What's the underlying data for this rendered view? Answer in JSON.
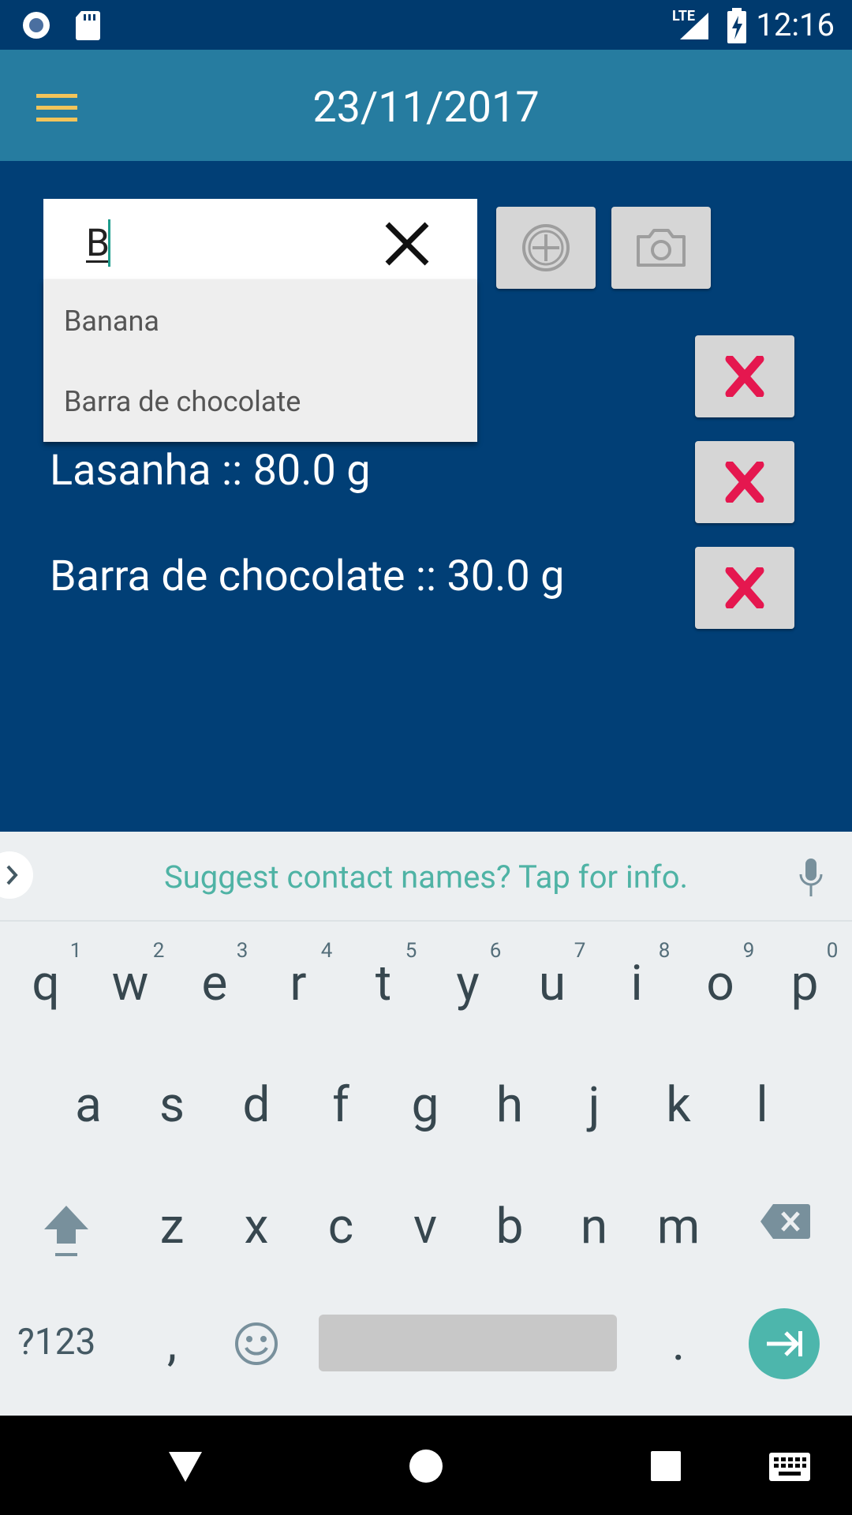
{
  "status_bar": {
    "time": "12:16",
    "network": "LTE",
    "icons": [
      "record-icon",
      "sd-card-icon",
      "signal-icon",
      "battery-charging-icon"
    ]
  },
  "toolbar": {
    "title": "23/11/2017",
    "menu_icon": "hamburger-menu-icon",
    "menu_color": "#F2C45A"
  },
  "search": {
    "value": "B",
    "suggestions": [
      "Banana",
      "Barra de chocolate"
    ]
  },
  "actions": {
    "add_icon": "add-circle-icon",
    "camera_icon": "camera-icon",
    "delete_icon": "delete-x-icon",
    "delete_color": "#E5174F"
  },
  "items": [
    {
      "label": "Lasanha :: 80.0 g"
    },
    {
      "label": "Barra de chocolate :: 30.0 g"
    }
  ],
  "keyboard": {
    "suggestion": "Suggest contact names? Tap for info.",
    "row1": [
      "q",
      "w",
      "e",
      "r",
      "t",
      "y",
      "u",
      "i",
      "o",
      "p"
    ],
    "row1_hints": [
      "1",
      "2",
      "3",
      "4",
      "5",
      "6",
      "7",
      "8",
      "9",
      "0"
    ],
    "row2": [
      "a",
      "s",
      "d",
      "f",
      "g",
      "h",
      "j",
      "k",
      "l"
    ],
    "row3": [
      "z",
      "x",
      "c",
      "v",
      "b",
      "n",
      "m"
    ],
    "symbols_label": "?123",
    "comma": ",",
    "period": ".",
    "accent": "#4DB6AC"
  }
}
